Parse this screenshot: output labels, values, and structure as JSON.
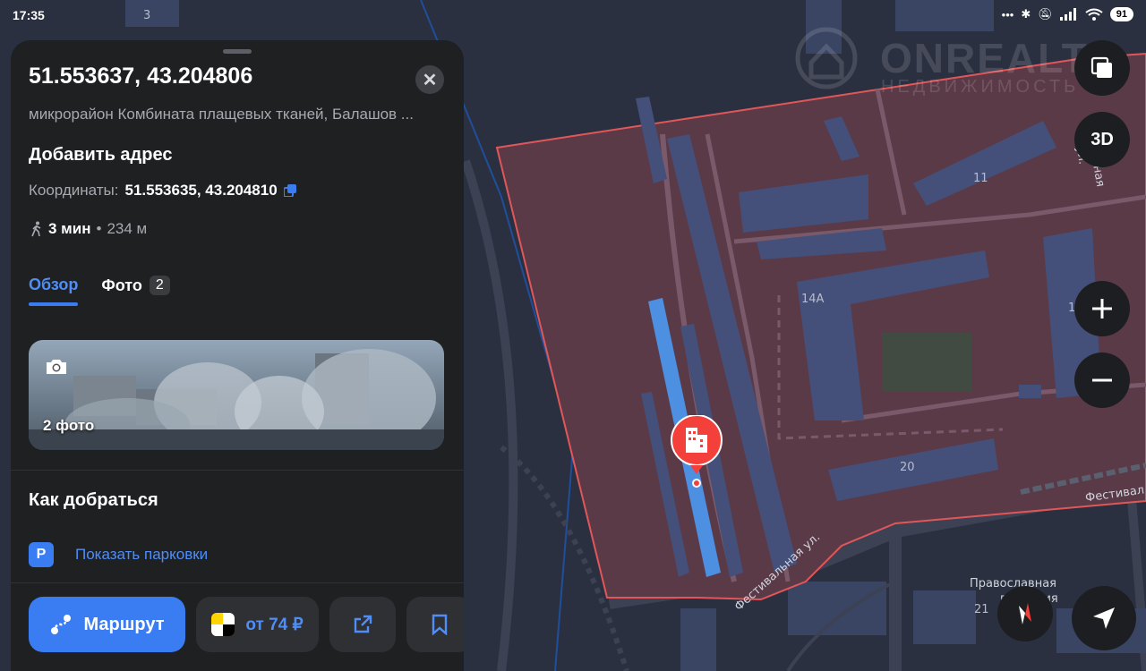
{
  "status_bar": {
    "time": "17:35",
    "battery": "91"
  },
  "watermark": {
    "brand": "ONREALT",
    "tagline": "НЕДВИЖИМОСТЬ"
  },
  "panel": {
    "title": "51.553637, 43.204806",
    "subtitle": "микрорайон Комбината плащевых тканей, Балашов ...",
    "add_address": "Добавить адрес",
    "coords_label": "Координаты:",
    "coords_value": "51.553635, 43.204810",
    "walk_time": "3 мин",
    "walk_sep": "•",
    "walk_distance": "234 м",
    "tabs": [
      {
        "label": "Обзор",
        "active": true
      },
      {
        "label": "Фото",
        "badge": "2",
        "active": false
      }
    ],
    "photo_count": "2 фото",
    "how_to_get": "Как добраться",
    "parking_icon": "P",
    "parking_label": "Показать парковки",
    "actions": {
      "route": "Маршрут",
      "taxi": "от 74 ₽"
    }
  },
  "map": {
    "labels": {
      "house_3": "3",
      "house_11": "11",
      "house_14a": "14А",
      "house_20": "20",
      "house_21": "21",
      "house_1x": "1",
      "street_festivalnaya": "Фестивальная ул.",
      "street_festival_right": "Фестивал",
      "street_vertical": "ольная ул.",
      "gymnasium_1": "Православная",
      "gymnasium_2": "гимназия"
    },
    "controls": {
      "three_d": "3D"
    }
  },
  "colors": {
    "accent": "#3a7cf2",
    "panel_bg": "#1f2022",
    "map_bg": "#2b3040",
    "area_fill": "#5b3a48",
    "area_stroke": "#e0575a",
    "pin": "#f4403a"
  }
}
